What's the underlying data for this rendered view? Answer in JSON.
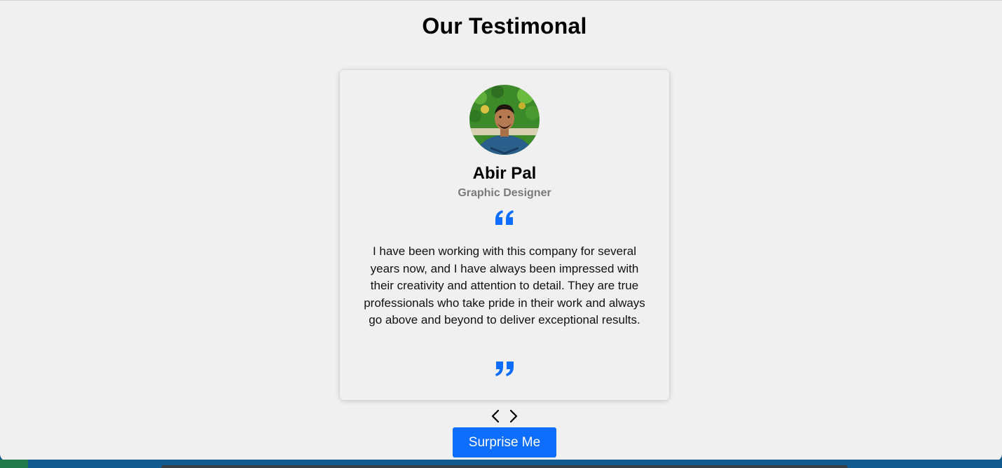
{
  "page": {
    "title": "Our Testimonal"
  },
  "testimonial": {
    "name": "Abir Pal",
    "role": "Graphic Designer",
    "text": "I have been working with this company for several years now, and I have always been impressed with their creativity and attention to detail. They are true professionals who take pride in their work and always go above and beyond to deliver exceptional results.",
    "avatar_icon": "person-photo-icon",
    "quote_open_icon": "quote-left-icon",
    "quote_close_icon": "quote-right-icon"
  },
  "navigation": {
    "prev_icon": "chevron-left-icon",
    "next_icon": "chevron-right-icon"
  },
  "actions": {
    "surprise_label": "Surprise Me"
  },
  "colors": {
    "accent": "#0d6efd",
    "background": "#f0f0f0",
    "role_text": "#7a7a7a"
  }
}
